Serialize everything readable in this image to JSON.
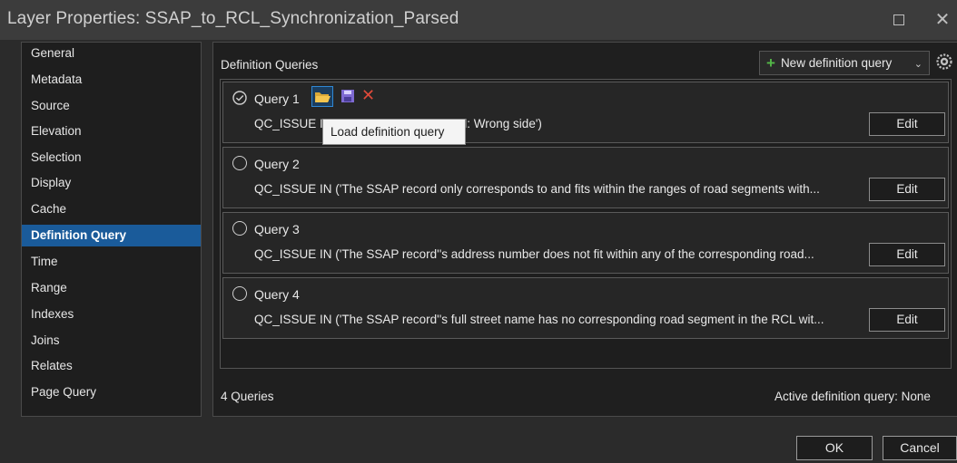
{
  "window": {
    "title": "Layer Properties: SSAP_to_RCL_Synchronization_Parsed",
    "maximize_icon": "square-icon",
    "close_label": "✕"
  },
  "nav": {
    "items": [
      {
        "label": "General"
      },
      {
        "label": "Metadata"
      },
      {
        "label": "Source"
      },
      {
        "label": "Elevation"
      },
      {
        "label": "Selection"
      },
      {
        "label": "Display"
      },
      {
        "label": "Cache"
      },
      {
        "label": "Definition Query"
      },
      {
        "label": "Time"
      },
      {
        "label": "Range"
      },
      {
        "label": "Indexes"
      },
      {
        "label": "Joins"
      },
      {
        "label": "Relates"
      },
      {
        "label": "Page Query"
      }
    ],
    "selected": "Definition Query",
    "selected_color": "#1a5b9a"
  },
  "panel": {
    "title": "Definition Queries",
    "new_query_label": "New definition query",
    "new_query_icon": "plus-icon",
    "settings_icon": "gear-icon",
    "tooltip": "Load definition query",
    "queries": [
      {
        "name": "Query 1",
        "expression_start": "QC_ISSUE I",
        "expression_end": "ail: Wrong side')",
        "edit_label": "Edit",
        "active": true
      },
      {
        "name": "Query 2",
        "expression": "QC_ISSUE IN ('The SSAP record only corresponds to and fits within the ranges of road segments with...",
        "edit_label": "Edit",
        "active": false
      },
      {
        "name": "Query 3",
        "expression": "QC_ISSUE IN ('The SSAP record''s address number does not fit within any of the corresponding road...",
        "edit_label": "Edit",
        "active": false
      },
      {
        "name": "Query 4",
        "expression": "QC_ISSUE IN ('The SSAP record''s full street name has no corresponding road segment in the RCL wit...",
        "edit_label": "Edit",
        "active": false
      }
    ],
    "query_count": "4 Queries",
    "active_query_text": "Active definition query: None"
  },
  "footer": {
    "ok_label": "OK",
    "cancel_label": "Cancel"
  },
  "colors": {
    "accent": "#2f88d6",
    "delete": "#e04a3a",
    "plus": "#53b848"
  }
}
